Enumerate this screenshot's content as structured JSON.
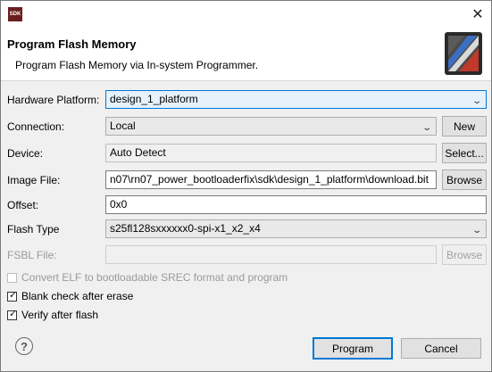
{
  "app_icon_text": "SDK",
  "icons": {
    "close": "close-icon",
    "help": "help-icon",
    "banner": "program-flash-banner-icon",
    "dropdown": "chevron-down-icon",
    "check": "checkmark-icon"
  },
  "header": {
    "title": "Program Flash Memory",
    "description": "Program Flash Memory via In-system Programmer."
  },
  "form": {
    "hardware_platform": {
      "label": "Hardware Platform:",
      "value": "design_1_platform"
    },
    "connection": {
      "label": "Connection:",
      "value": "Local",
      "button": "New"
    },
    "device": {
      "label": "Device:",
      "value": "Auto Detect",
      "button": "Select..."
    },
    "image_file": {
      "label": "Image File:",
      "value": "n07\\rn07_power_bootloaderfix\\sdk\\design_1_platform\\download.bit",
      "button": "Browse"
    },
    "offset": {
      "label": "Offset:",
      "value": "0x0"
    },
    "flash_type": {
      "label": "Flash Type",
      "value": "s25fl128sxxxxxx0-spi-x1_x2_x4"
    },
    "fsbl_file": {
      "label": "FSBL File:",
      "value": "",
      "button": "Browse"
    }
  },
  "options": {
    "convert_elf": {
      "label": "Convert ELF to bootloadable SREC format and program",
      "checked": false,
      "enabled": false
    },
    "blank_check": {
      "label": "Blank check after erase",
      "checked": true,
      "enabled": true
    },
    "verify": {
      "label": "Verify after flash",
      "checked": true,
      "enabled": true
    }
  },
  "footer": {
    "program_label": "Program",
    "cancel_label": "Cancel",
    "help_glyph": "?"
  },
  "colors": {
    "accent": "#0078d7",
    "dialog_bg": "#f0f0f0",
    "disabled_text": "#9a9a9a"
  }
}
